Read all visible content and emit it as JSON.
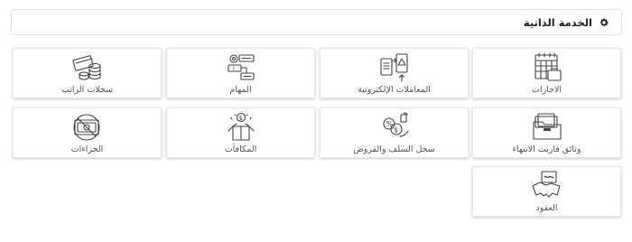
{
  "header": {
    "title": "الخدمة الذاتية",
    "icon": "gear-icon"
  },
  "tiles": {
    "leaves": {
      "label": "الاجازات",
      "icon": "calendar-icon"
    },
    "etrans": {
      "label": "المعاملات الإلكترونية",
      "icon": "electronic-documents-icon"
    },
    "tasks": {
      "label": "المهام",
      "icon": "tasks-icon"
    },
    "salary": {
      "label": "سجلات الراتب",
      "icon": "salary-money-icon"
    },
    "clearance": {
      "label": "وثائق فاريت الانتهاء",
      "icon": "documents-folder-icon"
    },
    "loans": {
      "label": "سجل السلف والقروض",
      "icon": "loan-money-icon"
    },
    "rewards": {
      "label": "المكافآت",
      "icon": "reward-box-icon"
    },
    "penalties": {
      "label": "الجزاءات",
      "icon": "no-money-icon"
    },
    "contracts": {
      "label": "العقود",
      "icon": "handshake-contract-icon"
    }
  }
}
